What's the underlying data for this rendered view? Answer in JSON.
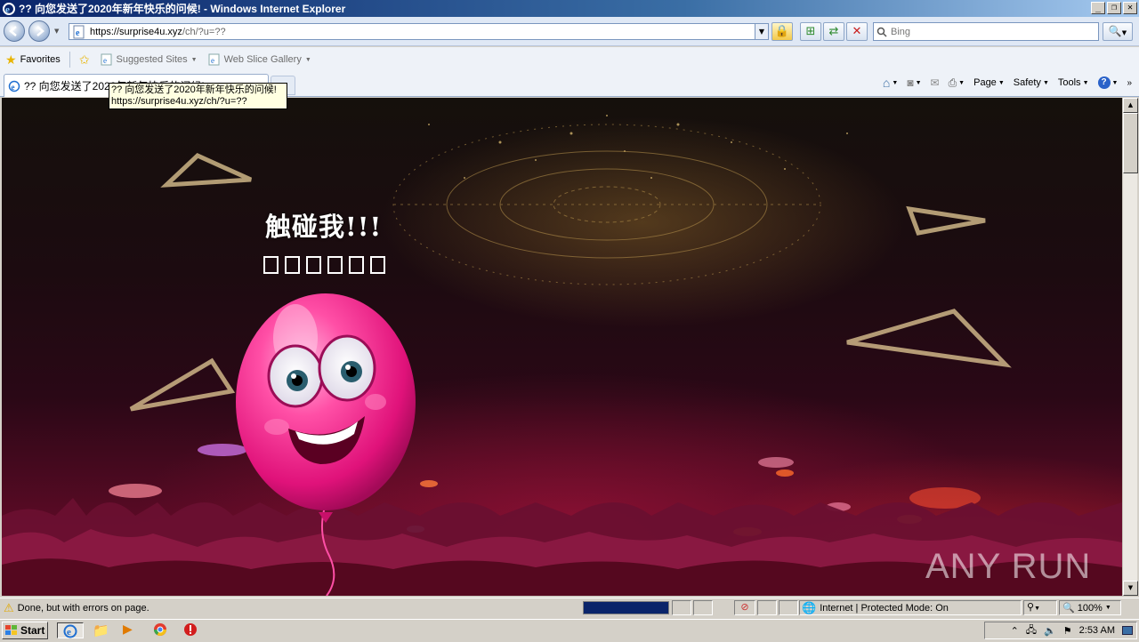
{
  "window": {
    "title": "?? 向您发送了2020年新年快乐的问候! - Windows Internet Explorer",
    "buttons": [
      "_",
      "❐",
      "✕"
    ]
  },
  "address_bar": {
    "url_main": "https://surprise4u.xyz",
    "url_rest": "/ch/?u=??",
    "search_placeholder": "Bing"
  },
  "favorites_bar": {
    "favorites_label": "Favorites",
    "items": [
      {
        "label": "Suggested Sites",
        "icon": "ie-page-icon"
      },
      {
        "label": "Web Slice Gallery",
        "icon": "ie-page-icon"
      }
    ]
  },
  "tab": {
    "title": "?? 向您发送了2020年新年快乐的问候!",
    "tooltip_title": "?? 向您发送了2020年新年快乐的问候!",
    "tooltip_url": "https://surprise4u.xyz/ch/?u=??"
  },
  "command_bar": {
    "page": "Page",
    "safety": "Safety",
    "tools": "Tools"
  },
  "page": {
    "headline": "触碰我!!!",
    "missing_glyph_count": 6,
    "watermark": "ANY RUN"
  },
  "status_bar": {
    "text": "Done, but with errors on page.",
    "progress_fraction": 1.0,
    "zone": "Internet | Protected Mode: On",
    "zoom": "100%"
  },
  "taskbar": {
    "start_label": "Start",
    "clock": "2:53 AM"
  },
  "colors": {
    "titlebar": "#0a246a",
    "chrome": "#d4d0c8",
    "balloon": "#ff3f9a"
  }
}
